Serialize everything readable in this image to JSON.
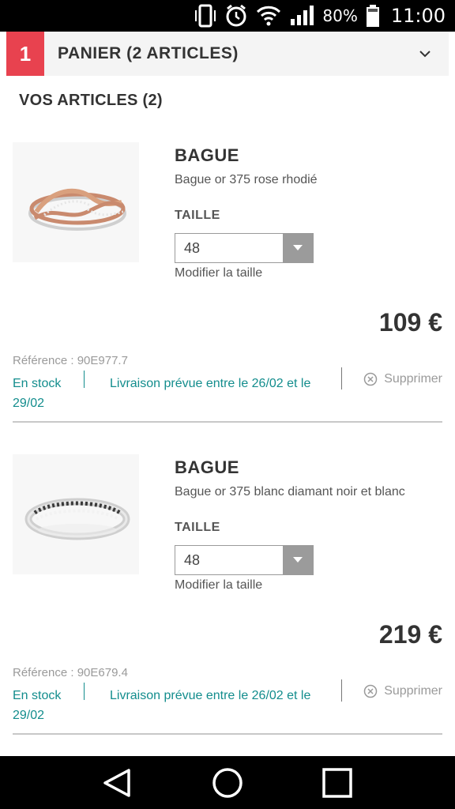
{
  "status_bar": {
    "battery": "80%",
    "time": "11:00"
  },
  "step": {
    "number": "1",
    "title": "PANIER (2 ARTICLES)"
  },
  "section_title": "VOS ARTICLES (2)",
  "items": [
    {
      "name": "BAGUE",
      "description": "Bague or 375 rose rhodié",
      "size_label": "TAILLE",
      "size_value": "48",
      "modify_label": "Modifier la taille",
      "price": "109 €",
      "reference": "Référence : 90E977.7",
      "stock": "En stock",
      "delivery": "Livraison prévue entre le 26/02 et le",
      "delivery_end": "29/02",
      "delete_label": "Supprimer",
      "ring_metal": "rose"
    },
    {
      "name": "BAGUE",
      "description": "Bague or 375 blanc diamant noir et blanc",
      "size_label": "TAILLE",
      "size_value": "48",
      "modify_label": "Modifier la taille",
      "price": "219 €",
      "reference": "Référence : 90E679.4",
      "stock": "En stock",
      "delivery": "Livraison prévue entre le 26/02 et le",
      "delivery_end": "29/02",
      "delete_label": "Supprimer",
      "ring_metal": "white"
    }
  ],
  "colors": {
    "accent": "#e8424f",
    "link": "#138d8d",
    "text": "#333333"
  },
  "icons": {
    "step_toggle": "chevron-down-icon",
    "delete": "close-circle-icon",
    "nav": [
      "back-icon",
      "home-icon",
      "recents-icon"
    ]
  }
}
